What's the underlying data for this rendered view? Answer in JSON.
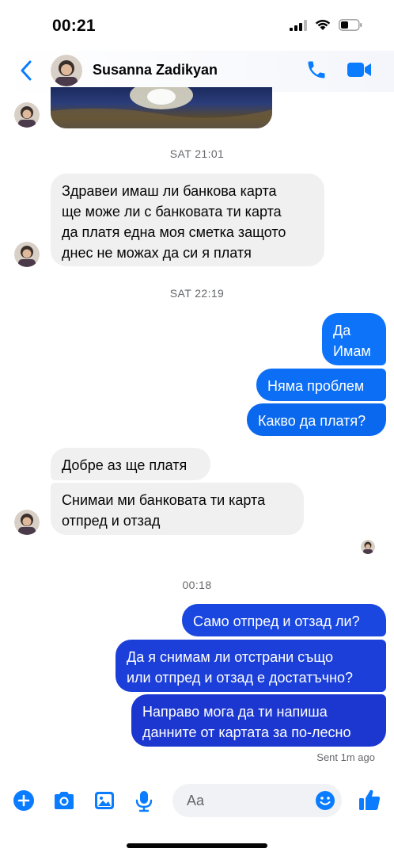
{
  "status_bar": {
    "time": "00:21"
  },
  "header": {
    "contact_name": "Susanna Zadikyan"
  },
  "timestamps": [
    "SAT 21:01",
    "SAT 22:19",
    "00:18"
  ],
  "messages": {
    "in1": [
      "Здравеи имаш ли банкова карта",
      "ще може ли с банковата ти карта",
      "да платя една моя сметка защото",
      "днес не можах да си я платя"
    ],
    "out1": [
      "Да",
      "Имам"
    ],
    "out2": "Няма проблем",
    "out3": "Какво да платя?",
    "in2": "Добре аз ще платя",
    "in3": [
      "Снимаи ми банковата ти карта",
      "отпред и отзад"
    ],
    "out4": "Само отпред и отзад ли?",
    "out5": [
      "Да я снимам ли отстрани също",
      "или отпред и отзад е достатъчно?"
    ],
    "out6": [
      "Направо мога да ти напиша",
      "данните от картата за по-лесно"
    ]
  },
  "sent_status": "Sent 1m ago",
  "composer": {
    "placeholder": "Aa"
  },
  "colors": {
    "accent": "#0a7cff",
    "outgoing_top": "#0a7cff",
    "outgoing_bottom": "#1b3fd6",
    "incoming": "#f0f0f0"
  }
}
